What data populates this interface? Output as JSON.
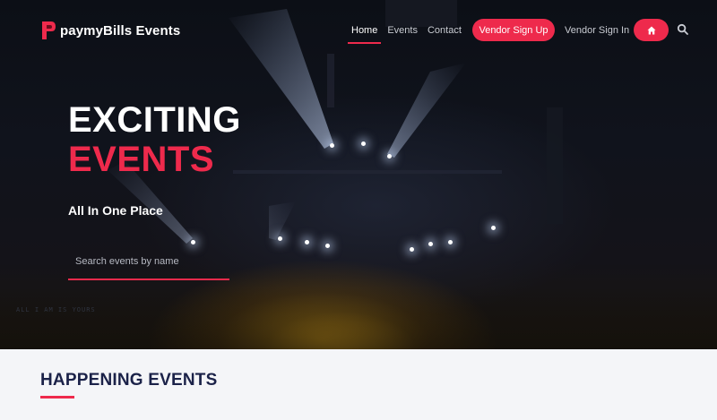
{
  "brand": {
    "name": "paymyBills Events"
  },
  "nav": {
    "links": [
      {
        "label": "Home",
        "active": true
      },
      {
        "label": "Events",
        "active": false
      },
      {
        "label": "Contact",
        "active": false
      }
    ],
    "vendor_signup": "Vendor Sign Up",
    "vendor_signin": "Vendor Sign In",
    "home_icon": "home-icon",
    "search_icon": "search-icon"
  },
  "hero": {
    "heading_line1": "EXCITING",
    "heading_line2": "EVENTS",
    "tagline": "All In One Place",
    "search_placeholder": "Search events by name",
    "background_watermark": "ALL I AM IS YOURS"
  },
  "section": {
    "title": "HAPPENING EVENTS"
  },
  "colors": {
    "accent": "#ee2a4c",
    "navy": "#1b2249",
    "hero_bg": "#0c0f16"
  }
}
